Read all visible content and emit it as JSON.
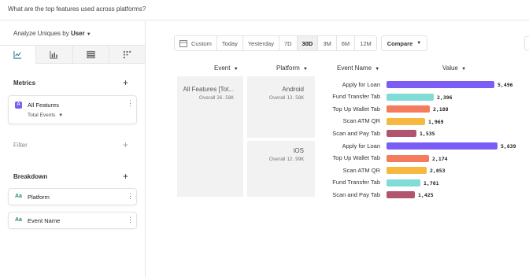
{
  "question": "What are the top features used across platforms?",
  "sidebar": {
    "analyze_prefix": "Analyze Uniques by",
    "analyze_value": "User",
    "metrics_title": "Metrics",
    "metric": {
      "badge": "A",
      "label": "All Features",
      "sub": "Total Events"
    },
    "filter_title": "Filter",
    "breakdown_title": "Breakdown",
    "breakdowns": [
      {
        "badge": "Aa",
        "label": "Platform"
      },
      {
        "badge": "Aa",
        "label": "Event Name"
      }
    ]
  },
  "toolbar": {
    "ranges": [
      "Custom",
      "Today",
      "Yesterday",
      "7D",
      "30D",
      "3M",
      "6M",
      "12M"
    ],
    "selected": "30D",
    "compare": "Compare"
  },
  "table": {
    "headers": {
      "event": "Event",
      "platform": "Platform",
      "event_name": "Event Name",
      "value": "Value"
    },
    "event": {
      "label": "All Features [Tot...",
      "overall_label": "Overall",
      "overall_value": "26.58K"
    },
    "platforms": [
      {
        "label": "Android",
        "overall_label": "Overall",
        "overall_value": "13.58K",
        "rows": [
          {
            "name": "Apply for Loan",
            "value": 5496,
            "value_label": "5,496",
            "color": "#7b5cf5"
          },
          {
            "name": "Fund Transfer Tab",
            "value": 2396,
            "value_label": "2,396",
            "color": "#7fdcd6"
          },
          {
            "name": "Top Up Wallet Tab",
            "value": 2188,
            "value_label": "2,188",
            "color": "#f47b5c"
          },
          {
            "name": "Scan ATM QR",
            "value": 1969,
            "value_label": "1,969",
            "color": "#f5b942"
          },
          {
            "name": "Scan and Pay Tab",
            "value": 1535,
            "value_label": "1,535",
            "color": "#b0546f"
          }
        ]
      },
      {
        "label": "iOS",
        "overall_label": "Overall",
        "overall_value": "12.99K",
        "rows": [
          {
            "name": "Apply for Loan",
            "value": 5639,
            "value_label": "5,639",
            "color": "#7b5cf5"
          },
          {
            "name": "Top Up Wallet Tab",
            "value": 2174,
            "value_label": "2,174",
            "color": "#f47b5c"
          },
          {
            "name": "Scan ATM QR",
            "value": 2053,
            "value_label": "2,053",
            "color": "#f5b942"
          },
          {
            "name": "Fund Transfer Tab",
            "value": 1701,
            "value_label": "1,701",
            "color": "#7fdcd6"
          },
          {
            "name": "Scan and Pay Tab",
            "value": 1425,
            "value_label": "1,425",
            "color": "#b0546f"
          }
        ]
      }
    ],
    "max_value": 5639
  }
}
